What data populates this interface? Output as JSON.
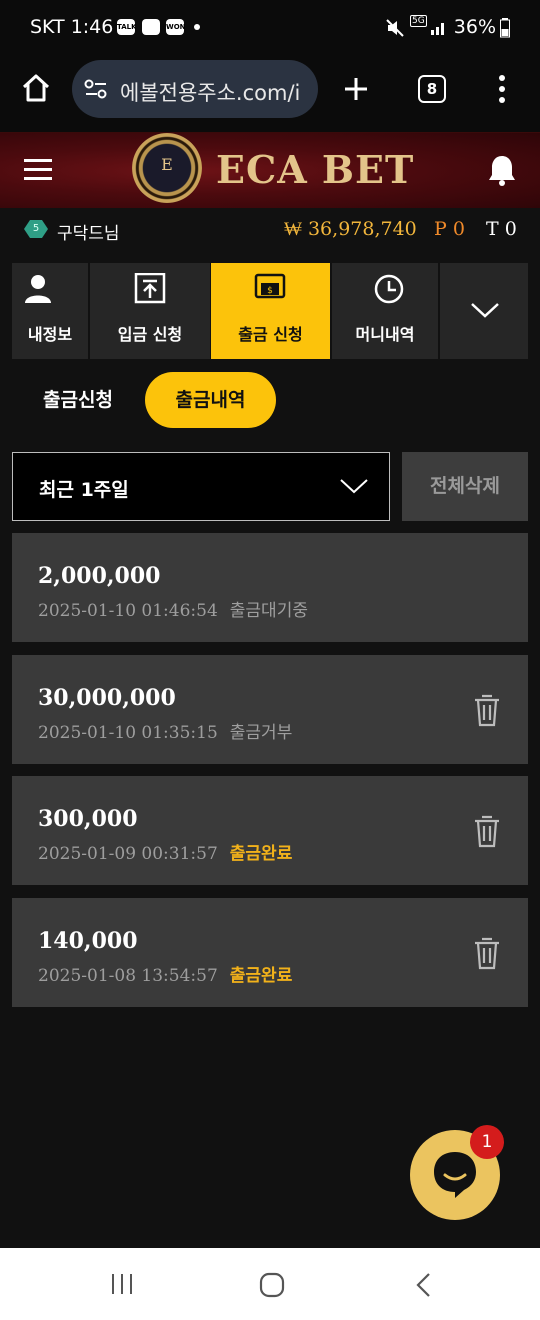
{
  "status_bar": {
    "carrier_time": "SKT 1:46",
    "notif_icons": [
      "TALK",
      "",
      "WON"
    ],
    "right": "36%",
    "network": "5G"
  },
  "browser": {
    "url": "에볼전용주소.com/i",
    "tab_count": "8"
  },
  "header": {
    "brand": "ECA BET",
    "emblem_letter": "E"
  },
  "user": {
    "level": "5",
    "name": "구닥드님",
    "money": "₩ 36,978,740",
    "point": "P 0",
    "t": "T 0"
  },
  "nav_tabs": [
    {
      "label": "내정보",
      "icon": "user-icon"
    },
    {
      "label": "입금 신청",
      "icon": "deposit-icon"
    },
    {
      "label": "출금 신청",
      "icon": "withdraw-icon",
      "active": true
    },
    {
      "label": "머니내역",
      "icon": "clock-icon"
    },
    {
      "label": "",
      "icon": "chevron-down-icon"
    }
  ],
  "sub_tabs": {
    "request": "출금신청",
    "history": "출금내역"
  },
  "filter": {
    "period": "최근 1주일",
    "delete_all": "전체삭제"
  },
  "records": [
    {
      "amount": "2,000,000",
      "datetime": "2025-01-10 01:46:54",
      "status": "출금대기중",
      "status_type": "pending",
      "deletable": false
    },
    {
      "amount": "30,000,000",
      "datetime": "2025-01-10 01:35:15",
      "status": "출금거부",
      "status_type": "pending",
      "deletable": true
    },
    {
      "amount": "300,000",
      "datetime": "2025-01-09 00:31:57",
      "status": "출금완료",
      "status_type": "done",
      "deletable": true
    },
    {
      "amount": "140,000",
      "datetime": "2025-01-08 13:54:57",
      "status": "출금완료",
      "status_type": "done",
      "deletable": true
    }
  ],
  "chat": {
    "badge": "1"
  },
  "colors": {
    "accent": "#fcc30b",
    "done_status": "#f2b21a",
    "money": "#f2b63c",
    "point": "#f08a2a"
  }
}
